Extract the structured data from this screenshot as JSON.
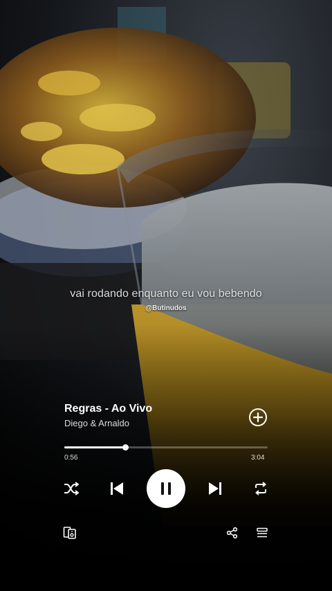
{
  "lyric": {
    "line": "vai rodando enquanto eu vou bebendo",
    "credit": "@Butinudos"
  },
  "track": {
    "title": "Regras - Ao Vivo",
    "artist": "Diego & Arnaldo"
  },
  "playback": {
    "elapsed": "0:56",
    "duration": "3:04",
    "progress_fraction": 0.3
  },
  "controls": {
    "add_icon": "plus-circle-icon",
    "shuffle_icon": "shuffle-icon",
    "previous_icon": "skip-previous-icon",
    "play_pause_icon": "pause-icon",
    "next_icon": "skip-next-icon",
    "repeat_icon": "repeat-icon",
    "devices_icon": "connect-devices-icon",
    "share_icon": "share-icon",
    "queue_icon": "queue-icon"
  },
  "colors": {
    "accent": "#ffffff",
    "beer": "#c8a030",
    "background": "#000000"
  }
}
